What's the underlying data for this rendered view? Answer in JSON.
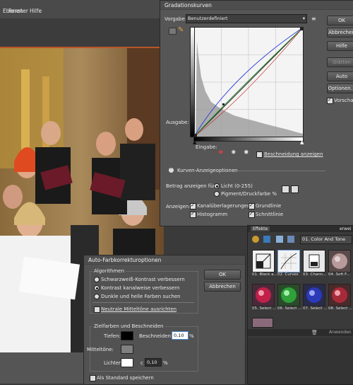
{
  "menu": {
    "items": [
      "Ebenen",
      "Fenster",
      "Hilfe"
    ]
  },
  "curves": {
    "title": "Gradationskurven",
    "preset_label": "Vorgabe:",
    "preset_value": "Benutzerdefiniert",
    "output_label": "Ausgabe:",
    "input_label": "Eingabe:",
    "clip_label": "Beschneidung anzeigen",
    "options_header": "Kurven-Anzeigeoptionen",
    "amount_label": "Betrag anzeigen für:",
    "light_label": "Licht (0-255)",
    "pigment_label": "Pigment/Druckfarbe %",
    "show_label": "Anzeigen:",
    "channel_overlay": "Kanalüberlagerungen",
    "baseline": "Grundlinie",
    "histogram": "Histogramm",
    "intersection": "Schnittlinie",
    "buttons": {
      "ok": "OK",
      "cancel": "Abbrechen",
      "help": "Hilfe",
      "smooth": "Glätten",
      "auto": "Auto",
      "options": "Optionen..."
    },
    "preview_label": "Vorschau"
  },
  "effects": {
    "tab": "Effekte",
    "tab2": "erwei",
    "category": "01. Color And Tone",
    "apply_label": "Anwenden",
    "items": [
      {
        "label": "01. Black a...",
        "color": "#f2f2f2"
      },
      {
        "label": "02. Curves",
        "color": "#f2f2f2"
      },
      {
        "label": "03. Chann...",
        "color": "#e8e8e8"
      },
      {
        "label": "04. Soft F...",
        "color": "#9a7a7a"
      },
      {
        "label": "05. Select ...",
        "color": "#b0204a"
      },
      {
        "label": "06. Select ...",
        "color": "#2f9a3a"
      },
      {
        "label": "07. Select ...",
        "color": "#2a3aa8"
      },
      {
        "label": "08. Select ...",
        "color": "#a02a3a"
      }
    ]
  },
  "auto_color": {
    "title": "Auto-Farbkorrekturoptionen",
    "algorithms_header": "Algorithmen",
    "opt1": "Schwarzweiß-Kontrast verbessern",
    "opt2": "Kontrast kanalweise verbessern",
    "opt3": "Dunkle und helle Farben suchen",
    "neutral": "Neutrale Mitteltöne ausrichten",
    "targets_header": "Zielfarben und Beschneiden",
    "shadows": "Tiefen:",
    "midtones": "Mitteltöne:",
    "highlights": "Lichter:",
    "clip": "Beschneiden:",
    "clip_shadows": "0,10",
    "clip_highlights": "0,10",
    "percent": "%",
    "c_label": "c",
    "save_default": "Als Standard speichern",
    "ok": "OK",
    "cancel": "Abbrechen"
  }
}
